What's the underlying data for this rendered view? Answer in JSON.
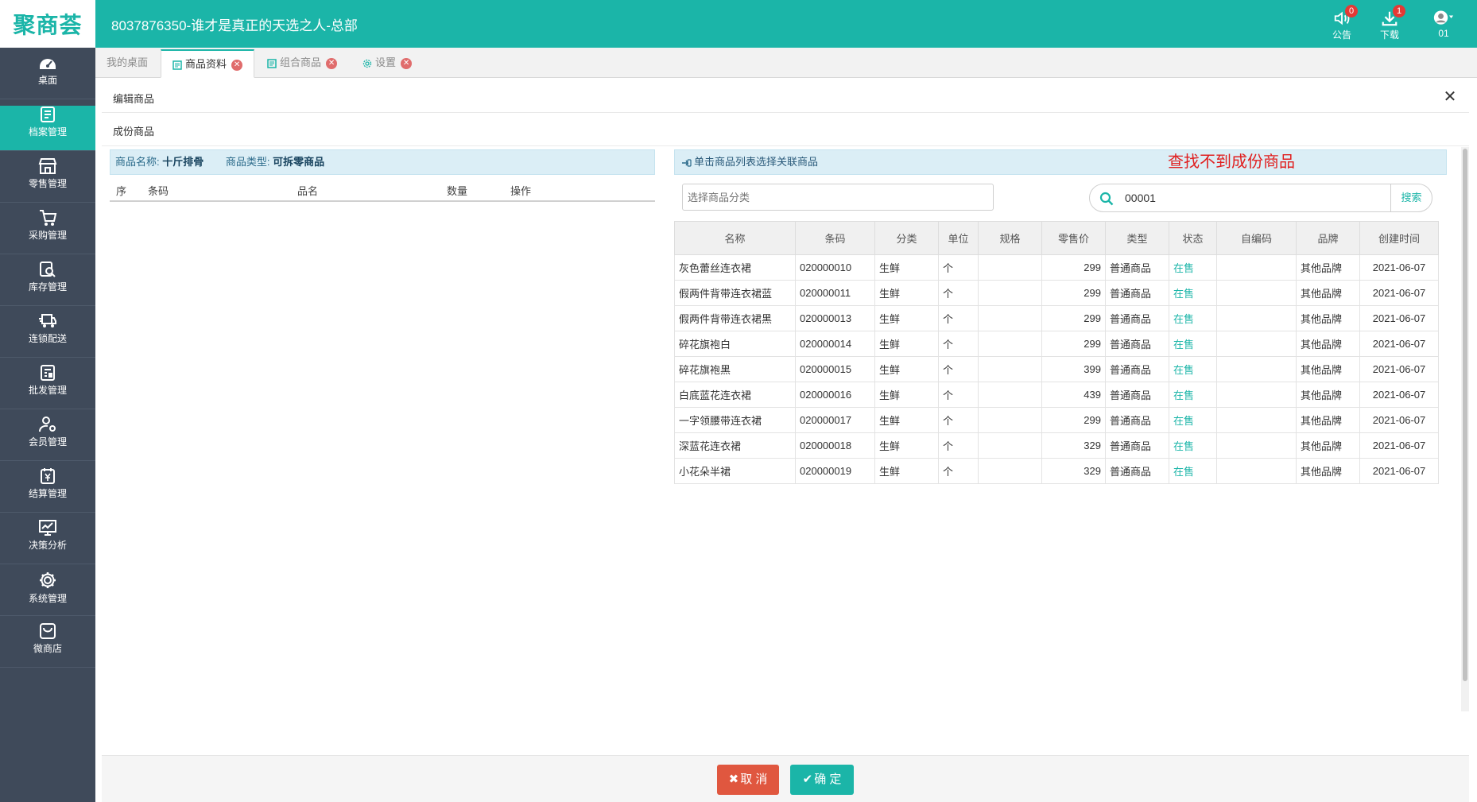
{
  "header": {
    "logo": "聚商荟",
    "title": "8037876350-谁才是真正的天选之人-总部",
    "notice": {
      "label": "公告",
      "badge": "0"
    },
    "download": {
      "label": "下载",
      "badge": "1"
    },
    "user": {
      "label": "01"
    }
  },
  "sidebar": {
    "items": [
      {
        "label": "桌面",
        "icon": "dashboard-icon"
      },
      {
        "label": "档案管理",
        "icon": "archive-icon"
      },
      {
        "label": "零售管理",
        "icon": "store-icon"
      },
      {
        "label": "采购管理",
        "icon": "cart-icon"
      },
      {
        "label": "库存管理",
        "icon": "inventory-icon"
      },
      {
        "label": "连锁配送",
        "icon": "truck-icon"
      },
      {
        "label": "批发管理",
        "icon": "wholesale-icon"
      },
      {
        "label": "会员管理",
        "icon": "member-icon"
      },
      {
        "label": "结算管理",
        "icon": "settlement-icon"
      },
      {
        "label": "决策分析",
        "icon": "chart-icon"
      },
      {
        "label": "系统管理",
        "icon": "gear-icon"
      },
      {
        "label": "微商店",
        "icon": "shop-bag-icon"
      }
    ],
    "active_index": 1
  },
  "tabs": [
    {
      "label": "我的桌面"
    },
    {
      "label": "商品资料"
    },
    {
      "label": "组合商品"
    },
    {
      "label": "设置"
    }
  ],
  "dialog": {
    "title": "编辑商品",
    "section_title": "成份商品"
  },
  "left": {
    "name_label": "商品名称:",
    "name_value": "十斤排骨",
    "type_label": "商品类型:",
    "type_value": "可拆零商品",
    "columns": {
      "seq": "序",
      "barcode": "条码",
      "name": "品名",
      "qty": "数量",
      "op": "操作"
    }
  },
  "right": {
    "hint": "单击商品列表选择关联商品",
    "warning": "查找不到成份商品",
    "category_placeholder": "选择商品分类",
    "search_value": "00001",
    "search_button": "搜索",
    "columns": [
      "名称",
      "条码",
      "分类",
      "单位",
      "规格",
      "零售价",
      "类型",
      "状态",
      "自编码",
      "品牌",
      "创建时间"
    ],
    "rows": [
      {
        "name": "灰色蕾丝连衣裙",
        "barcode": "020000010",
        "category": "生鲜",
        "unit": "个",
        "spec": "",
        "price": "299",
        "type": "普通商品",
        "status": "在售",
        "code": "",
        "brand": "其他品牌",
        "created": "2021-06-07"
      },
      {
        "name": "假两件背带连衣裙蓝",
        "barcode": "020000011",
        "category": "生鲜",
        "unit": "个",
        "spec": "",
        "price": "299",
        "type": "普通商品",
        "status": "在售",
        "code": "",
        "brand": "其他品牌",
        "created": "2021-06-07"
      },
      {
        "name": "假两件背带连衣裙黑",
        "barcode": "020000013",
        "category": "生鲜",
        "unit": "个",
        "spec": "",
        "price": "299",
        "type": "普通商品",
        "status": "在售",
        "code": "",
        "brand": "其他品牌",
        "created": "2021-06-07"
      },
      {
        "name": "碎花旗袍白",
        "barcode": "020000014",
        "category": "生鲜",
        "unit": "个",
        "spec": "",
        "price": "299",
        "type": "普通商品",
        "status": "在售",
        "code": "",
        "brand": "其他品牌",
        "created": "2021-06-07"
      },
      {
        "name": "碎花旗袍黑",
        "barcode": "020000015",
        "category": "生鲜",
        "unit": "个",
        "spec": "",
        "price": "399",
        "type": "普通商品",
        "status": "在售",
        "code": "",
        "brand": "其他品牌",
        "created": "2021-06-07"
      },
      {
        "name": "白底蓝花连衣裙",
        "barcode": "020000016",
        "category": "生鲜",
        "unit": "个",
        "spec": "",
        "price": "439",
        "type": "普通商品",
        "status": "在售",
        "code": "",
        "brand": "其他品牌",
        "created": "2021-06-07"
      },
      {
        "name": "一字领腰带连衣裙",
        "barcode": "020000017",
        "category": "生鲜",
        "unit": "个",
        "spec": "",
        "price": "299",
        "type": "普通商品",
        "status": "在售",
        "code": "",
        "brand": "其他品牌",
        "created": "2021-06-07"
      },
      {
        "name": "深蓝花连衣裙",
        "barcode": "020000018",
        "category": "生鲜",
        "unit": "个",
        "spec": "",
        "price": "329",
        "type": "普通商品",
        "status": "在售",
        "code": "",
        "brand": "其他品牌",
        "created": "2021-06-07"
      },
      {
        "name": "小花朵半裙",
        "barcode": "020000019",
        "category": "生鲜",
        "unit": "个",
        "spec": "",
        "price": "329",
        "type": "普通商品",
        "status": "在售",
        "code": "",
        "brand": "其他品牌",
        "created": "2021-06-07"
      }
    ]
  },
  "footer": {
    "cancel_label": "取 消",
    "ok_label": "确 定"
  },
  "colors": {
    "brand": "#1bb5a8",
    "sidebar": "#3f4a5a",
    "cancel": "#e0573f",
    "warning": "#e02020"
  }
}
